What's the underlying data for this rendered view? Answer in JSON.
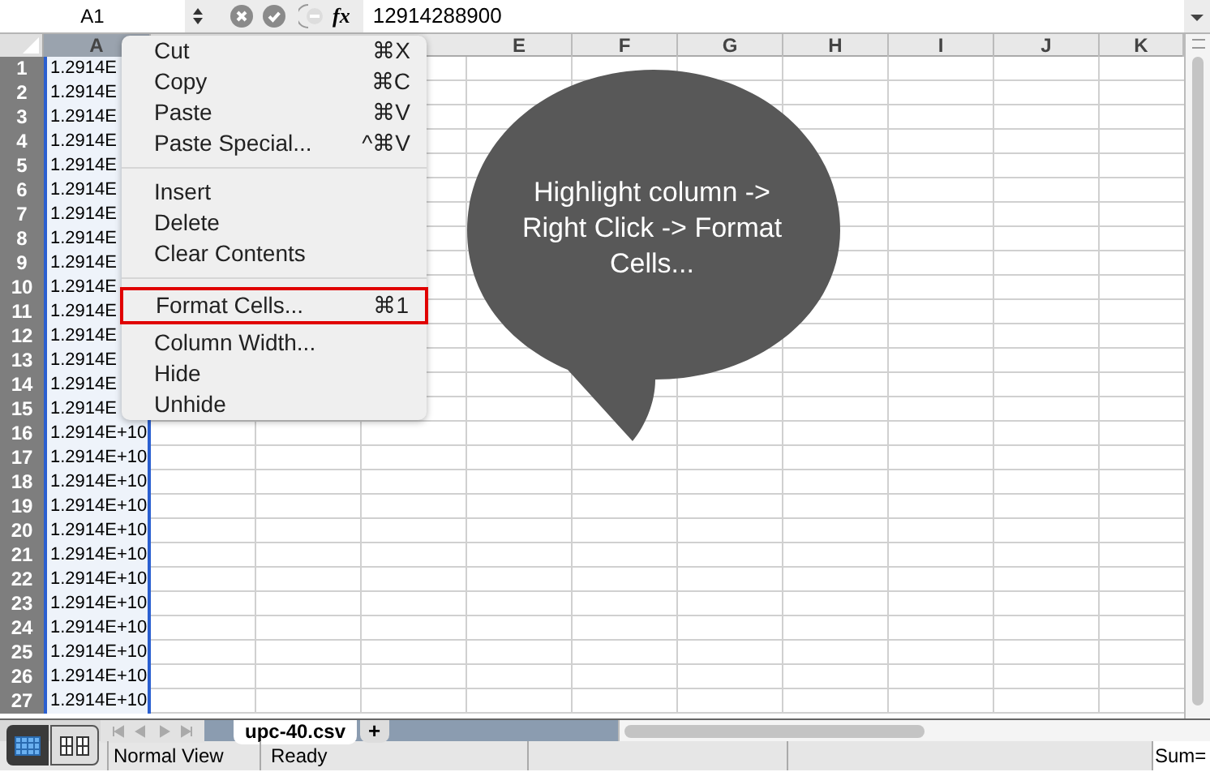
{
  "formula_bar": {
    "name_box": "A1",
    "formula_icon": "fx",
    "value": "12914288900"
  },
  "columns": [
    {
      "label": "A",
      "selected": true
    },
    {
      "label": "E",
      "selected": false
    },
    {
      "label": "F",
      "selected": false
    },
    {
      "label": "G",
      "selected": false
    },
    {
      "label": "H",
      "selected": false
    },
    {
      "label": "I",
      "selected": false
    },
    {
      "label": "J",
      "selected": false
    },
    {
      "label": "K",
      "selected": false
    }
  ],
  "rows": [
    {
      "number": "1",
      "a": "1.2914E"
    },
    {
      "number": "2",
      "a": "1.2914E"
    },
    {
      "number": "3",
      "a": "1.2914E"
    },
    {
      "number": "4",
      "a": "1.2914E"
    },
    {
      "number": "5",
      "a": "1.2914E"
    },
    {
      "number": "6",
      "a": "1.2914E"
    },
    {
      "number": "7",
      "a": "1.2914E"
    },
    {
      "number": "8",
      "a": "1.2914E"
    },
    {
      "number": "9",
      "a": "1.2914E"
    },
    {
      "number": "10",
      "a": "1.2914E"
    },
    {
      "number": "11",
      "a": "1.2914E"
    },
    {
      "number": "12",
      "a": "1.2914E"
    },
    {
      "number": "13",
      "a": "1.2914E"
    },
    {
      "number": "14",
      "a": "1.2914E"
    },
    {
      "number": "15",
      "a": "1.2914E"
    },
    {
      "number": "16",
      "a": "1.2914E+10"
    },
    {
      "number": "17",
      "a": "1.2914E+10"
    },
    {
      "number": "18",
      "a": "1.2914E+10"
    },
    {
      "number": "19",
      "a": "1.2914E+10"
    },
    {
      "number": "20",
      "a": "1.2914E+10"
    },
    {
      "number": "21",
      "a": "1.2914E+10"
    },
    {
      "number": "22",
      "a": "1.2914E+10"
    },
    {
      "number": "23",
      "a": "1.2914E+10"
    },
    {
      "number": "24",
      "a": "1.2914E+10"
    },
    {
      "number": "25",
      "a": "1.2914E+10"
    },
    {
      "number": "26",
      "a": "1.2914E+10"
    },
    {
      "number": "27",
      "a": "1.2914E+10"
    }
  ],
  "context_menu": [
    {
      "kind": "item",
      "label": "Cut",
      "shortcut": "⌘X",
      "highlighted": false
    },
    {
      "kind": "item",
      "label": "Copy",
      "shortcut": "⌘C",
      "highlighted": false
    },
    {
      "kind": "item",
      "label": "Paste",
      "shortcut": "⌘V",
      "highlighted": false
    },
    {
      "kind": "item",
      "label": "Paste Special...",
      "shortcut": "^⌘V",
      "highlighted": false
    },
    {
      "kind": "separator"
    },
    {
      "kind": "item",
      "label": "Insert",
      "highlighted": false
    },
    {
      "kind": "item",
      "label": "Delete",
      "highlighted": false
    },
    {
      "kind": "item",
      "label": "Clear Contents",
      "highlighted": false
    },
    {
      "kind": "separator"
    },
    {
      "kind": "item",
      "label": "Format Cells...",
      "shortcut": "⌘1",
      "highlighted": true
    },
    {
      "kind": "item",
      "label": "Column Width...",
      "highlighted": false
    },
    {
      "kind": "item",
      "label": "Hide",
      "highlighted": false
    },
    {
      "kind": "item",
      "label": "Unhide",
      "highlighted": false
    }
  ],
  "callout": "Highlight column -> Right Click -> Format Cells...",
  "sheet_tabs": [
    {
      "label": "upc-40.csv",
      "selected": true
    }
  ],
  "add_sheet": "+",
  "status_bar": {
    "view": "Normal View",
    "state": "Ready",
    "sum": "Sum="
  }
}
